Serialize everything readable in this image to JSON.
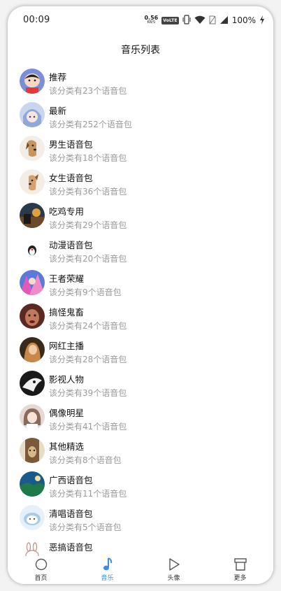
{
  "status_bar": {
    "time": "00:09",
    "net_speed_value": "0.56",
    "net_speed_unit": "KB/S",
    "volte": "VoLTE",
    "battery": "100%"
  },
  "header": {
    "title": "音乐列表"
  },
  "list": {
    "items": [
      {
        "title": "推荐",
        "subtitle": "该分类有23个语音包",
        "avatar_color": "#7b8fd6",
        "icon": "cartoon-boy-avatar-icon"
      },
      {
        "title": "最新",
        "subtitle": "该分类有252个语音包",
        "avatar_color": "#b8c8e8",
        "icon": "anime-girl-avatar-icon"
      },
      {
        "title": "男生语音包",
        "subtitle": "该分类有18个语音包",
        "avatar_color": "#f2ebe4",
        "icon": "dog-avatar-icon"
      },
      {
        "title": "女生语音包",
        "subtitle": "该分类有36个语音包",
        "avatar_color": "#f2ebe4",
        "icon": "dog-avatar-icon"
      },
      {
        "title": "吃鸡专用",
        "subtitle": "该分类有29个语音包",
        "avatar_color": "#2b3a4a",
        "icon": "game-scene-avatar-icon"
      },
      {
        "title": "动漫语音包",
        "subtitle": "该分类有20个语音包",
        "avatar_color": "#ffffff",
        "icon": "penguin-avatar-icon"
      },
      {
        "title": "王者荣耀",
        "subtitle": "该分类有9个语音包",
        "avatar_color": "#d06ab8",
        "icon": "game-hero-avatar-icon"
      },
      {
        "title": "搞怪鬼畜",
        "subtitle": "该分类有24个语音包",
        "avatar_color": "#6a3a32",
        "icon": "funny-face-avatar-icon"
      },
      {
        "title": "网红主播",
        "subtitle": "该分类有28个语音包",
        "avatar_color": "#8a5a3a",
        "icon": "streamer-avatar-icon"
      },
      {
        "title": "影视人物",
        "subtitle": "该分类有39个语音包",
        "avatar_color": "#222222",
        "icon": "film-character-avatar-icon"
      },
      {
        "title": "偶像明星",
        "subtitle": "该分类有41个语音包",
        "avatar_color": "#d9c8c0",
        "icon": "idol-avatar-icon"
      },
      {
        "title": "其他精选",
        "subtitle": "该分类有8个语音包",
        "avatar_color": "#7a5a3a",
        "icon": "cat-avatar-icon"
      },
      {
        "title": "广西语音包",
        "subtitle": "该分类有11个语音包",
        "avatar_color": "#1f6a4a",
        "icon": "landscape-avatar-icon"
      },
      {
        "title": "清唱语音包",
        "subtitle": "该分类有5个语音包",
        "avatar_color": "#cfe2f2",
        "icon": "cloud-character-avatar-icon"
      },
      {
        "title": "恶搞语音包",
        "subtitle": "",
        "avatar_color": "#ffffff",
        "icon": "bunny-avatar-icon"
      }
    ]
  },
  "bottom_nav": {
    "items": [
      {
        "label": "首页",
        "icon": "home-circle-icon"
      },
      {
        "label": "音乐",
        "icon": "music-note-icon"
      },
      {
        "label": "头像",
        "icon": "play-triangle-icon"
      },
      {
        "label": "更多",
        "icon": "more-box-icon"
      }
    ],
    "active_index": 1,
    "active_color": "#3a8ee6"
  }
}
